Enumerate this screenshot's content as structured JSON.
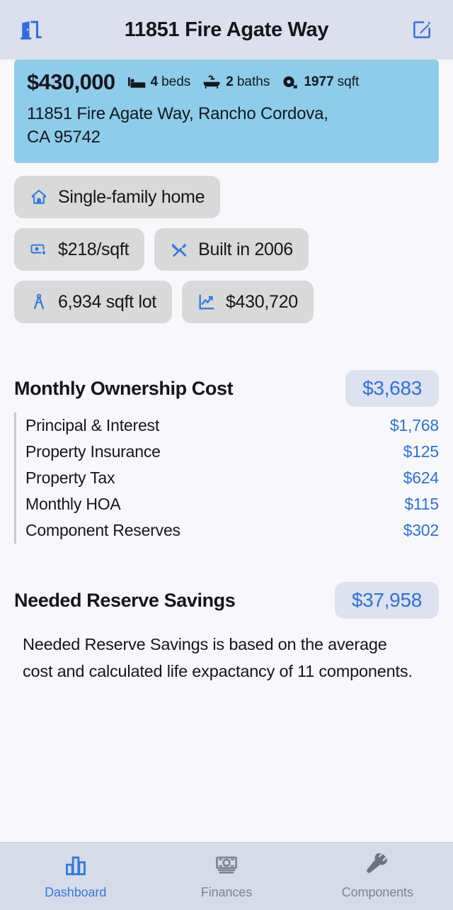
{
  "header": {
    "title": "11851 Fire Agate Way",
    "left_icon": "door-exit-icon",
    "right_icon": "edit-compose-icon"
  },
  "summary": {
    "price": "$430,000",
    "beds_value": "4",
    "beds_unit": "beds",
    "baths_value": "2",
    "baths_unit": "baths",
    "sqft_value": "1977",
    "sqft_unit": "sqft",
    "address_line1": "11851 Fire Agate Way, Rancho Cordova,",
    "address_line2": "CA  95742"
  },
  "chips": [
    {
      "icon": "home-icon",
      "label": "Single-family home"
    },
    {
      "icon": "price-per-sqft-icon",
      "label": "$218/sqft"
    },
    {
      "icon": "tools-icon",
      "label": "Built in 2006"
    },
    {
      "icon": "compass-icon",
      "label": "6,934 sqft lot"
    },
    {
      "icon": "chart-line-icon",
      "label": "$430,720"
    }
  ],
  "ownership": {
    "title": "Monthly Ownership Cost",
    "total": "$3,683",
    "items": [
      {
        "label": "Principal & Interest",
        "value": "$1,768"
      },
      {
        "label": "Property Insurance",
        "value": "$125"
      },
      {
        "label": "Property Tax",
        "value": "$624"
      },
      {
        "label": "Monthly HOA",
        "value": "$115"
      },
      {
        "label": "Component Reserves",
        "value": "$302"
      }
    ]
  },
  "reserve": {
    "title": "Needed Reserve Savings",
    "total": "$37,958",
    "note": "Needed Reserve Savings is based on the average cost and calculated life expactancy of 11 components."
  },
  "tabs": [
    {
      "label": "Dashboard",
      "icon": "bar-chart-icon",
      "active": true
    },
    {
      "label": "Finances",
      "icon": "money-icon",
      "active": false
    },
    {
      "label": "Components",
      "icon": "wrench-icon",
      "active": false
    }
  ],
  "colors": {
    "accent_blue": "#2e6fdb",
    "tab_active": "#2e7ae0",
    "card_blue": "#8ecdea",
    "chip_gray": "#d9d9d9",
    "badge_bg": "#dde2f0",
    "header_bg": "#dbdfee",
    "page_bg": "#f8f8fc"
  }
}
